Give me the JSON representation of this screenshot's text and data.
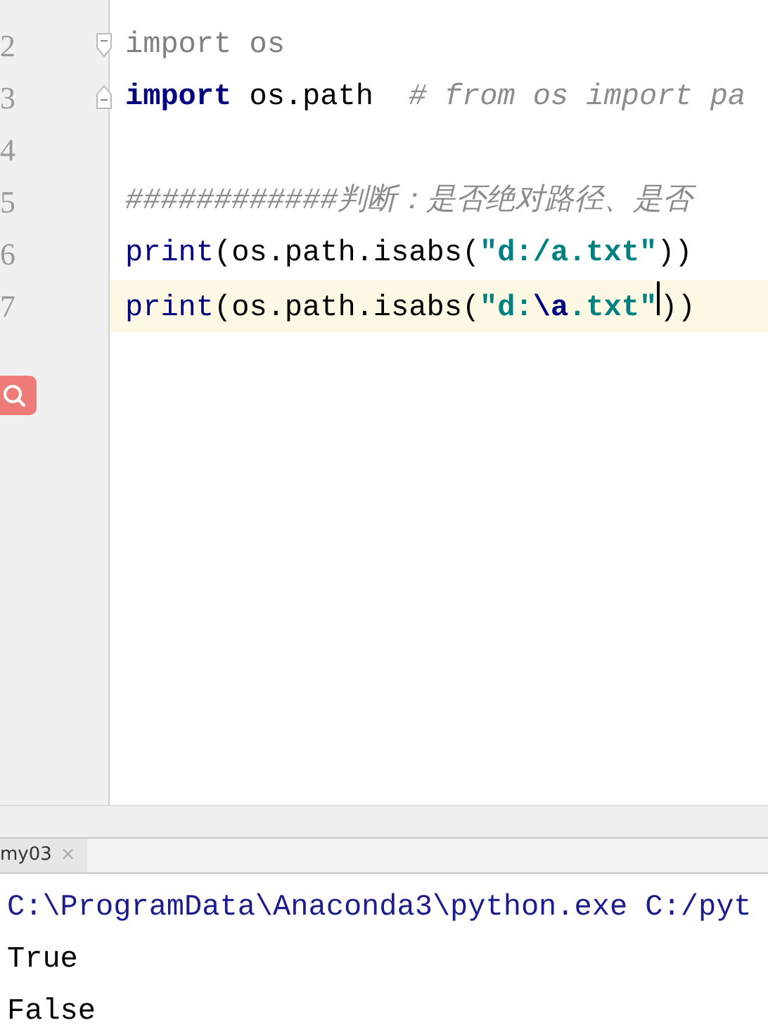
{
  "editor": {
    "lines": [
      {
        "number": "2",
        "current": false,
        "fold_close": true,
        "fold_open": false,
        "tokens": [
          {
            "kind": "unused",
            "text": "import os"
          }
        ]
      },
      {
        "number": "3",
        "current": false,
        "fold_close": false,
        "fold_open": true,
        "tokens": [
          {
            "kind": "keyword",
            "text": "import"
          },
          {
            "kind": "plain",
            "text": " os.path  "
          },
          {
            "kind": "comment",
            "text": "# from os import pa"
          }
        ]
      },
      {
        "number": "4",
        "current": false,
        "fold_close": false,
        "fold_open": false
      },
      {
        "number": "5",
        "current": false,
        "fold_close": false,
        "fold_open": false,
        "tokens": [
          {
            "kind": "comment",
            "text": "############判断：是否绝对路径、是否"
          }
        ]
      },
      {
        "number": "6",
        "current": false,
        "fold_close": false,
        "fold_open": false,
        "tokens": [
          {
            "kind": "builtin",
            "text": "print"
          },
          {
            "kind": "plain",
            "text": "(os.path.isabs("
          },
          {
            "kind": "string",
            "text": "\"d:/a.txt\""
          },
          {
            "kind": "plain",
            "text": "))"
          }
        ]
      },
      {
        "number": "7",
        "current": true,
        "fold_close": false,
        "fold_open": false,
        "tokens": [
          {
            "kind": "builtin",
            "text": "print"
          },
          {
            "kind": "plain",
            "text": "(os.path.isabs("
          },
          {
            "kind": "string",
            "text": "\"d:"
          },
          {
            "kind": "escape",
            "text": "\\a"
          },
          {
            "kind": "string",
            "text": ".txt\""
          },
          {
            "kind": "caret"
          },
          {
            "kind": "plain",
            "text": "))"
          }
        ]
      }
    ]
  },
  "console": {
    "tabs": [
      {
        "label": "my03",
        "selected": true,
        "close": "×"
      }
    ],
    "output": [
      {
        "kind": "command",
        "text": "C:\\ProgramData\\Anaconda3\\python.exe C:/pyt"
      },
      {
        "kind": "stdout",
        "text": "True"
      },
      {
        "kind": "stdout",
        "text": "False"
      }
    ]
  }
}
